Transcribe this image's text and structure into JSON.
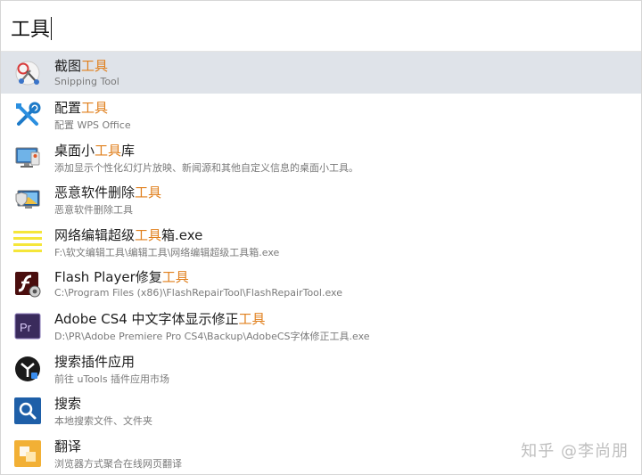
{
  "search": {
    "query": "工具"
  },
  "results": [
    {
      "title_before": "截图",
      "title_hl": "工具",
      "title_after": "",
      "desc": "Snipping Tool",
      "icon": "scissors-icon"
    },
    {
      "title_before": "配置",
      "title_hl": "工具",
      "title_after": "",
      "desc": "配置 WPS Office",
      "icon": "tools-icon"
    },
    {
      "title_before": "桌面小",
      "title_hl": "工具",
      "title_after": "库",
      "desc": "添加显示个性化幻灯片放映、新闻源和其他自定义信息的桌面小工具。",
      "icon": "monitor-icon"
    },
    {
      "title_before": "恶意软件删除",
      "title_hl": "工具",
      "title_after": "",
      "desc": "恶意软件删除工具",
      "icon": "shield-monitor-icon"
    },
    {
      "title_before": "网络编辑超级",
      "title_hl": "工具",
      "title_after": "箱.exe",
      "desc": "F:\\软文编辑工具\\编辑工具\\网络编辑超级工具箱.exe",
      "icon": "yellow-lines-icon"
    },
    {
      "title_before": "Flash Player修复",
      "title_hl": "工具",
      "title_after": "",
      "desc": "C:\\Program Files (x86)\\FlashRepairTool\\FlashRepairTool.exe",
      "icon": "flash-repair-icon"
    },
    {
      "title_before": "Adobe CS4 中文字体显示修正",
      "title_hl": "工具",
      "title_after": "",
      "desc": "D:\\PR\\Adobe Premiere Pro CS4\\Backup\\AdobeCS字体修正工具.exe",
      "icon": "premiere-pro-icon"
    },
    {
      "title_before": "搜索插件应用",
      "title_hl": "",
      "title_after": "",
      "desc": "前往 uTools 插件应用市场",
      "icon": "utools-icon"
    },
    {
      "title_before": "搜索",
      "title_hl": "",
      "title_after": "",
      "desc": "本地搜索文件、文件夹",
      "icon": "search-icon"
    },
    {
      "title_before": "翻译",
      "title_hl": "",
      "title_after": "",
      "desc": "浏览器方式聚合在线网页翻译",
      "icon": "translate-icon"
    }
  ],
  "watermark": "知乎 @李尚朋",
  "colors": {
    "highlight": "#e07f1c",
    "selected_row": "#dfe3e9"
  }
}
